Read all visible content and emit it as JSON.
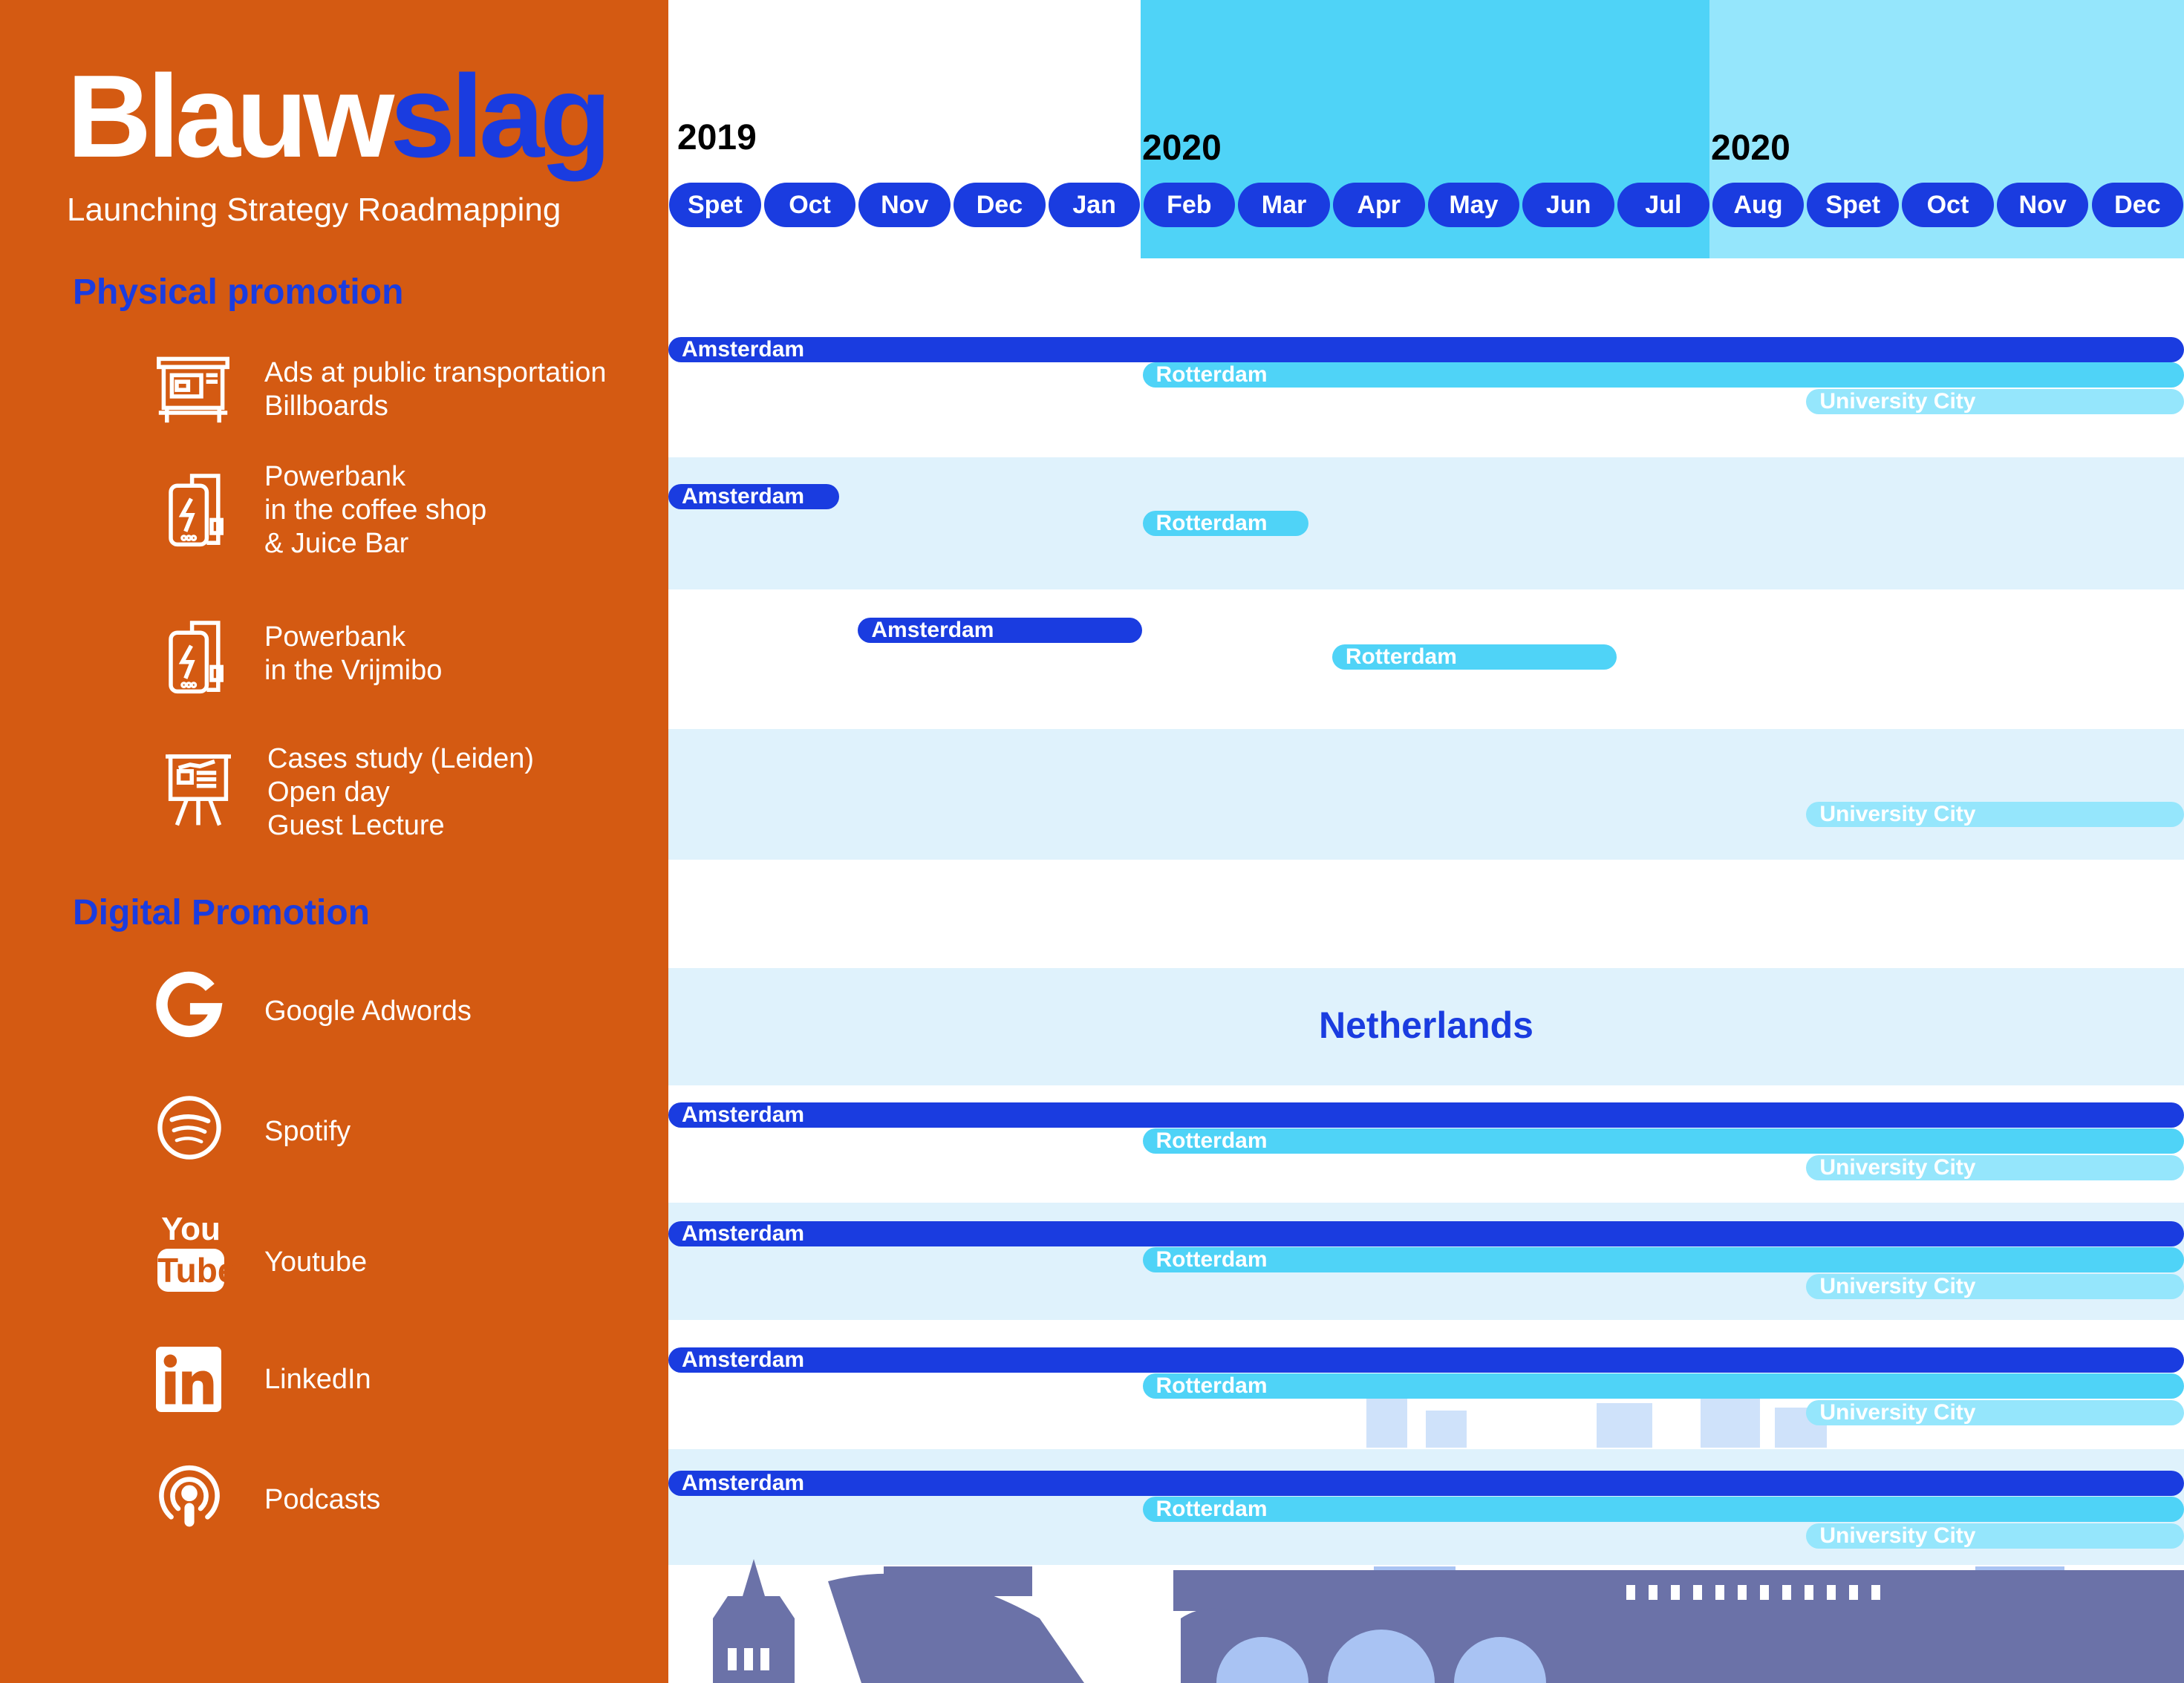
{
  "brand": {
    "title_white": "Blauw",
    "title_blue": "slag",
    "subtitle": "Launching Strategy Roadmapping"
  },
  "sections": {
    "physical": "Physical promotion",
    "digital": "Digital Promotion"
  },
  "physical_items": [
    {
      "icon": "bus-stop-billboard-icon",
      "lines": [
        "Ads at public transportation",
        "Billboards"
      ]
    },
    {
      "icon": "powerbank-icon",
      "lines": [
        "Powerbank",
        "in the coffee shop",
        "& Juice Bar"
      ]
    },
    {
      "icon": "powerbank-icon",
      "lines": [
        "Powerbank",
        "in the Vrijmibo"
      ]
    },
    {
      "icon": "presentation-board-icon",
      "lines": [
        "Cases study (Leiden)",
        "Open day",
        "Guest Lecture"
      ]
    }
  ],
  "digital_items": [
    {
      "icon": "google-icon",
      "label": "Google Adwords"
    },
    {
      "icon": "spotify-icon",
      "label": "Spotify"
    },
    {
      "icon": "youtube-icon",
      "label": "Youtube",
      "logo_text": [
        "You",
        "Tube"
      ]
    },
    {
      "icon": "linkedin-icon",
      "label": "LinkedIn"
    },
    {
      "icon": "podcast-icon",
      "label": "Podcasts"
    }
  ],
  "timeline": {
    "years": [
      "2019",
      "2020",
      "2020"
    ],
    "months": [
      "Spet",
      "Oct",
      "Nov",
      "Dec",
      "Jan",
      "Feb",
      "Mar",
      "Apr",
      "May",
      "Jun",
      "Jul",
      "Aug",
      "Spet",
      "Oct",
      "Nov",
      "Dec"
    ],
    "band_colors": {
      "phase2": "#4fd3f7",
      "phase3": "#95e6fc",
      "dark": "#1a3ce0"
    },
    "netherlands_label": "Netherlands",
    "rows": [
      {
        "name": "ads-public-transport",
        "bars": [
          {
            "label": "Amsterdam",
            "start": 0,
            "end": 16,
            "style": "dark"
          },
          {
            "label": "Rotterdam",
            "start": 5,
            "end": 16,
            "style": "mid"
          },
          {
            "label": "University City",
            "start": 12,
            "end": 16,
            "style": "light"
          }
        ]
      },
      {
        "name": "powerbank-coffee",
        "bars": [
          {
            "label": "Amsterdam",
            "start": 0,
            "end": 1.8,
            "style": "dark"
          },
          {
            "label": "Rotterdam",
            "start": 5,
            "end": 6.75,
            "style": "mid"
          }
        ]
      },
      {
        "name": "powerbank-vrijmibo",
        "bars": [
          {
            "label": "Amsterdam",
            "start": 2,
            "end": 5,
            "style": "dark"
          },
          {
            "label": "Rotterdam",
            "start": 7,
            "end": 10,
            "style": "mid"
          }
        ]
      },
      {
        "name": "case-study",
        "bars": [
          {
            "label": "University City",
            "start": 12,
            "end": 16,
            "style": "light"
          }
        ]
      },
      {
        "name": "spotify",
        "bars": [
          {
            "label": "Amsterdam",
            "start": 0,
            "end": 16,
            "style": "dark"
          },
          {
            "label": "Rotterdam",
            "start": 5,
            "end": 16,
            "style": "mid"
          },
          {
            "label": "University City",
            "start": 12,
            "end": 16,
            "style": "light"
          }
        ]
      },
      {
        "name": "youtube",
        "bars": [
          {
            "label": "Amsterdam",
            "start": 0,
            "end": 16,
            "style": "dark"
          },
          {
            "label": "Rotterdam",
            "start": 5,
            "end": 16,
            "style": "mid"
          },
          {
            "label": "University City",
            "start": 12,
            "end": 16,
            "style": "light"
          }
        ]
      },
      {
        "name": "linkedin",
        "bars": [
          {
            "label": "Amsterdam",
            "start": 0,
            "end": 16,
            "style": "dark"
          },
          {
            "label": "Rotterdam",
            "start": 5,
            "end": 16,
            "style": "mid"
          },
          {
            "label": "University City",
            "start": 12,
            "end": 16,
            "style": "light"
          }
        ]
      },
      {
        "name": "podcasts",
        "bars": [
          {
            "label": "Amsterdam",
            "start": 0,
            "end": 16,
            "style": "dark"
          },
          {
            "label": "Rotterdam",
            "start": 5,
            "end": 16,
            "style": "mid"
          },
          {
            "label": "University City",
            "start": 12,
            "end": 16,
            "style": "light"
          }
        ]
      }
    ]
  }
}
